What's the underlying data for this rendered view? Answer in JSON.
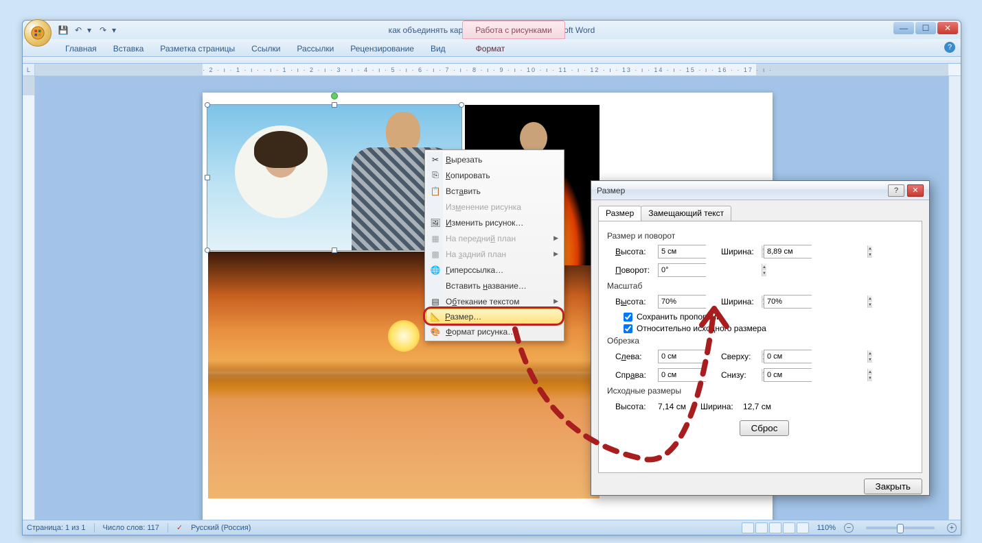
{
  "titlebar": {
    "document_title": "как объединять картинки в Пэйнт Нет - Microsoft Word"
  },
  "contextual_tab_group": "Работа с рисунками",
  "ribbon": {
    "tabs": [
      "Главная",
      "Вставка",
      "Разметка страницы",
      "Ссылки",
      "Рассылки",
      "Рецензирование",
      "Вид"
    ],
    "contextual_tab": "Формат"
  },
  "ruler_corner": "L",
  "context_menu": {
    "items": [
      {
        "label": "Вырезать",
        "icon": "cut-icon",
        "disabled": false,
        "submenu": false
      },
      {
        "label": "Копировать",
        "icon": "copy-icon",
        "disabled": false,
        "submenu": false
      },
      {
        "label": "Вставить",
        "icon": "paste-icon",
        "disabled": false,
        "submenu": false
      },
      {
        "label": "Изменение рисунка",
        "icon": "",
        "disabled": true,
        "submenu": false
      },
      {
        "label": "Изменить рисунок…",
        "icon": "edit-picture-icon",
        "disabled": false,
        "submenu": false
      },
      {
        "label": "На передний план",
        "icon": "bring-front-icon",
        "disabled": true,
        "submenu": true
      },
      {
        "label": "На задний план",
        "icon": "send-back-icon",
        "disabled": true,
        "submenu": true
      },
      {
        "label": "Гиперссылка…",
        "icon": "hyperlink-icon",
        "disabled": false,
        "submenu": false
      },
      {
        "label": "Вставить название…",
        "icon": "",
        "disabled": false,
        "submenu": false
      },
      {
        "label": "Обтекание текстом",
        "icon": "wrap-text-icon",
        "disabled": false,
        "submenu": true
      },
      {
        "label": "Размер…",
        "icon": "size-icon",
        "disabled": false,
        "submenu": false,
        "highlight": true
      },
      {
        "label": "Формат рисунка…",
        "icon": "format-picture-icon",
        "disabled": false,
        "submenu": false
      }
    ]
  },
  "dialog": {
    "title": "Размер",
    "tabs": {
      "active": "Размер",
      "inactive": "Замещающий текст"
    },
    "groups": {
      "size_rotate": {
        "label": "Размер и поворот",
        "height_label": "Высота:",
        "height_value": "5 см",
        "width_label": "Ширина:",
        "width_value": "8,89 см",
        "rotation_label": "Поворот:",
        "rotation_value": "0°"
      },
      "scale": {
        "label": "Масштаб",
        "height_label": "Высота:",
        "height_value": "70%",
        "width_label": "Ширина:",
        "width_value": "70%",
        "lock_aspect": {
          "label": "Сохранить пропорции",
          "checked": true
        },
        "relative_original": {
          "label": "Относительно исходного размера",
          "checked": true
        }
      },
      "crop": {
        "label": "Обрезка",
        "left_label": "Слева:",
        "left_value": "0 см",
        "top_label": "Сверху:",
        "top_value": "0 см",
        "right_label": "Справа:",
        "right_value": "0 см",
        "bottom_label": "Снизу:",
        "bottom_value": "0 см"
      },
      "original": {
        "label": "Исходные размеры",
        "height_label": "Высота:",
        "height_value": "7,14 см",
        "width_label": "Ширина:",
        "width_value": "12,7 см",
        "reset_btn": "Сброс"
      }
    },
    "close_btn": "Закрыть"
  },
  "statusbar": {
    "page": "Страница: 1 из 1",
    "words": "Число слов: 117",
    "language": "Русский (Россия)",
    "zoom": "110%"
  },
  "ruler_marks": "· 2 · ı · 1 · ı ·   · ı · 1 · ı · 2 · ı · 3 · ı · 4 · ı · 5 · ı · 6 · ı · 7 · ı · 8 · ı · 9 · ı · 10 · ı · 11 · ı · 12 · ı · 13 · ı · 14 · ı · 15 · ı · 16 ·   · 17 · ı ·"
}
